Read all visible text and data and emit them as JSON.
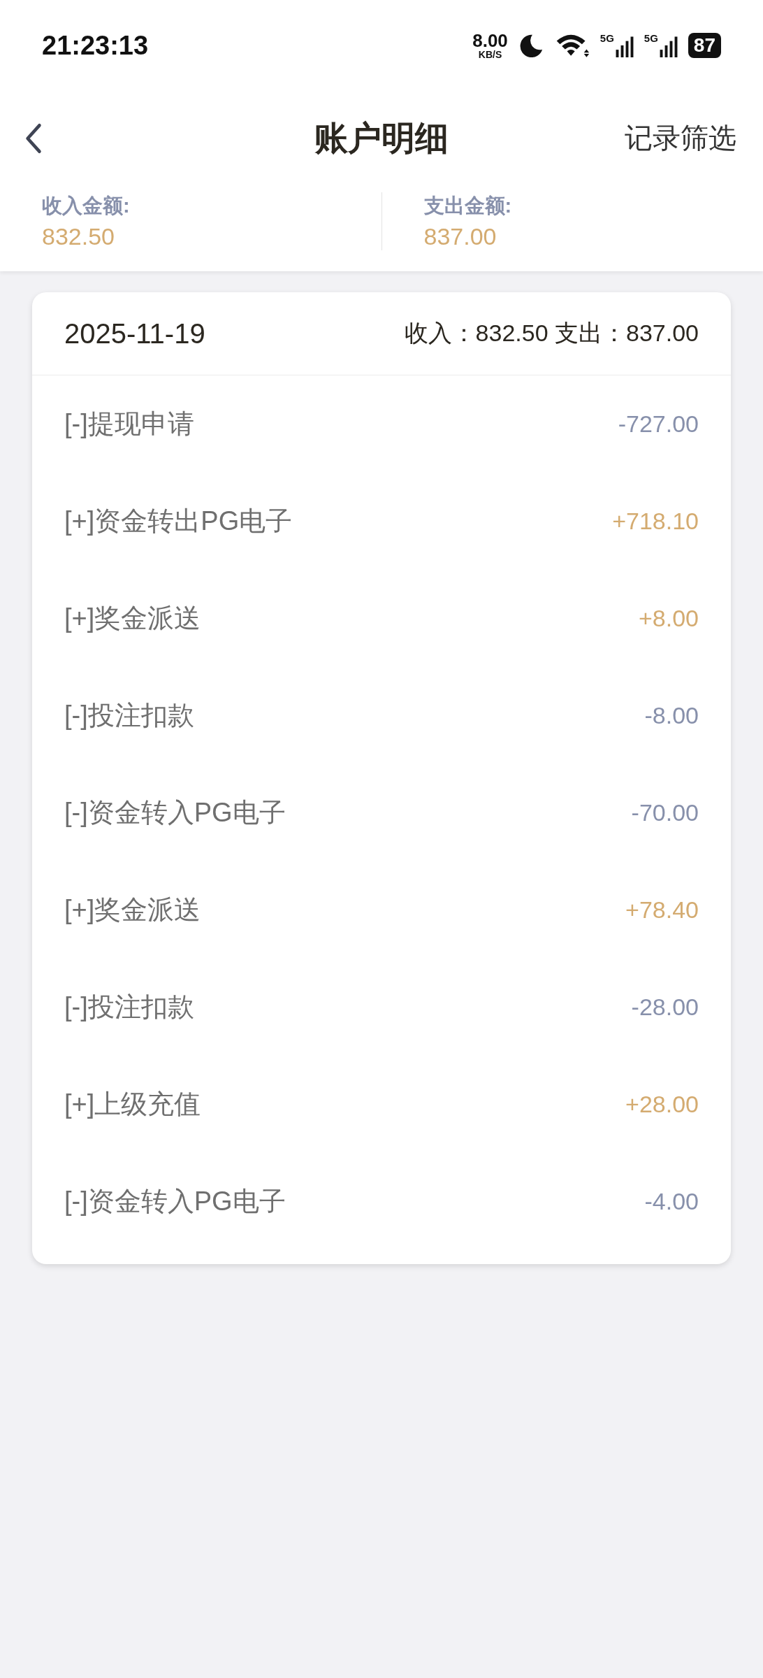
{
  "status_bar": {
    "time": "21:23:13",
    "speed": "8.00",
    "speed_unit": "KB/S",
    "networks": [
      "5G",
      "5G"
    ],
    "battery": "87"
  },
  "header": {
    "title": "账户明细",
    "action": "记录筛选"
  },
  "summary": [
    {
      "label": "收入金额:",
      "value": "832.50"
    },
    {
      "label": "支出金额:",
      "value": "837.00"
    }
  ],
  "day": {
    "date": "2025-11-19",
    "totals": "收入：832.50 支出：837.00",
    "rows": [
      {
        "name": "[-]提现申请",
        "amount": "-727.00",
        "kind": "expense"
      },
      {
        "name": "[+]资金转出PG电子",
        "amount": "+718.10",
        "kind": "income"
      },
      {
        "name": "[+]奖金派送",
        "amount": "+8.00",
        "kind": "income"
      },
      {
        "name": "[-]投注扣款",
        "amount": "-8.00",
        "kind": "expense"
      },
      {
        "name": "[-]资金转入PG电子",
        "amount": "-70.00",
        "kind": "expense"
      },
      {
        "name": "[+]奖金派送",
        "amount": "+78.40",
        "kind": "income"
      },
      {
        "name": "[-]投注扣款",
        "amount": "-28.00",
        "kind": "expense"
      },
      {
        "name": "[+]上级充值",
        "amount": "+28.00",
        "kind": "income"
      },
      {
        "name": "[-]资金转入PG电子",
        "amount": "-4.00",
        "kind": "expense"
      }
    ]
  }
}
